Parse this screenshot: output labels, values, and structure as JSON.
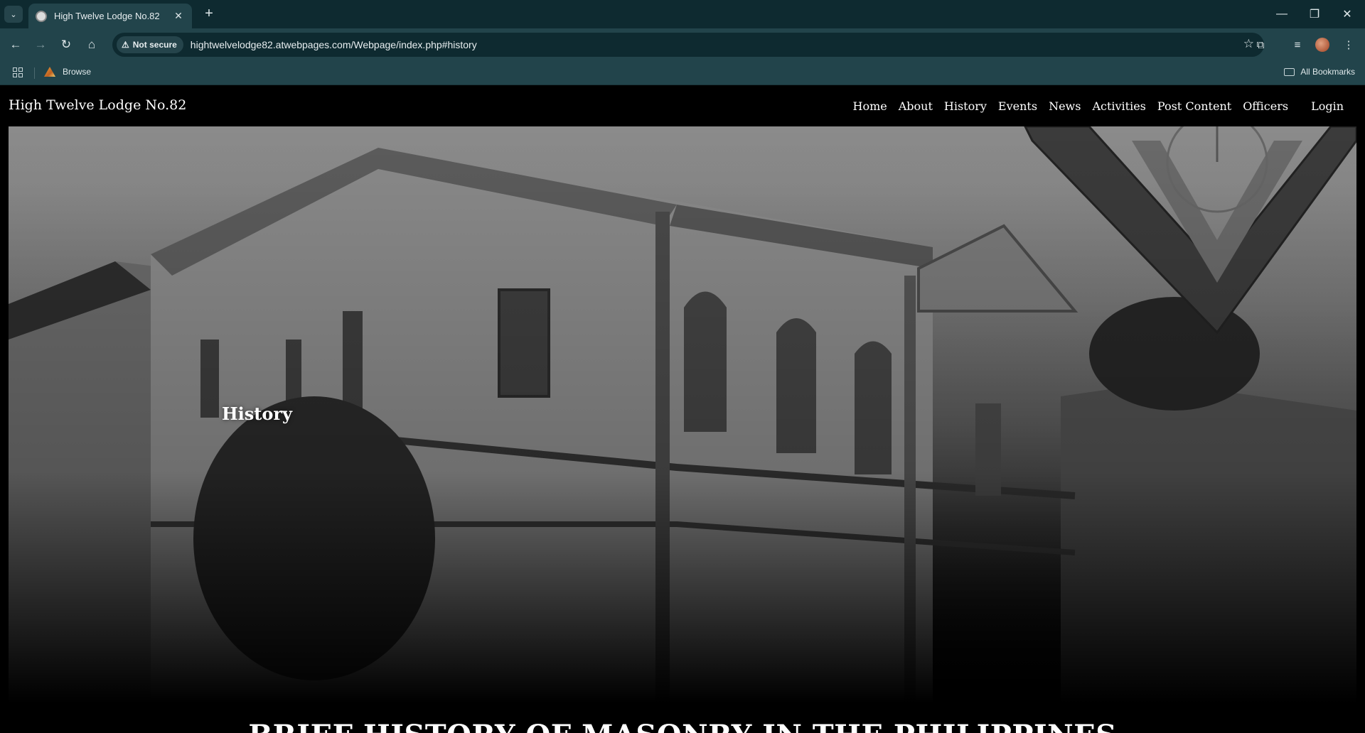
{
  "browser": {
    "tab_title": "High Twelve Lodge No.82",
    "security_label": "Not secure",
    "url": "hightwelvelodge82.atwebpages.com/Webpage/index.php#history",
    "bookmark_browse": "Browse",
    "all_bookmarks": "All Bookmarks"
  },
  "site": {
    "brand": "High Twelve Lodge No.82",
    "nav": [
      "Home",
      "About",
      "History",
      "Events",
      "News",
      "Activities",
      "Post Content",
      "Officers"
    ],
    "login": "Login"
  },
  "hero": {
    "heading": "History"
  },
  "section": {
    "title": "BRIEF HISTORY OF MASONRY IN THE PHILIPPINES"
  }
}
